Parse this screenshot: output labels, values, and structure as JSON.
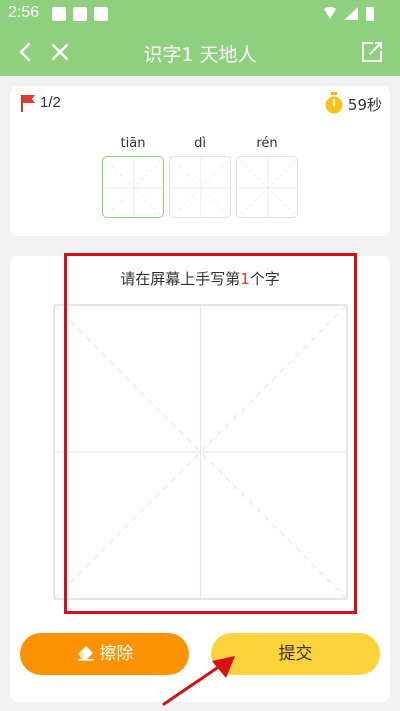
{
  "status_bar": {
    "time": "2:56"
  },
  "app_bar": {
    "title": "识字1 天地人"
  },
  "progress": {
    "label": "1/2"
  },
  "timer": {
    "label": "59秒"
  },
  "characters": [
    {
      "pinyin": "tiān",
      "active": true
    },
    {
      "pinyin": "dì",
      "active": false
    },
    {
      "pinyin": "rén",
      "active": false
    }
  ],
  "writing": {
    "prompt_before": "请在屏幕上手写第",
    "prompt_number": "1",
    "prompt_after": "个字"
  },
  "buttons": {
    "erase": "擦除",
    "submit": "提交"
  },
  "colors": {
    "header_green": "#8fd07f",
    "erase_orange": "#fd9204",
    "submit_yellow": "#fdd33b",
    "highlight_red": "#d80f17"
  }
}
